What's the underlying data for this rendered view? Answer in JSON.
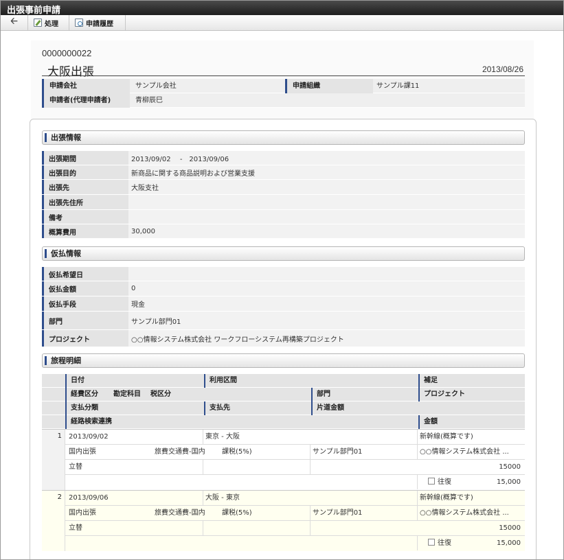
{
  "window": {
    "title": "出張事前申請"
  },
  "toolbar": {
    "back_icon": "arrow-left-icon",
    "process_label": "処理",
    "history_label": "申請履歴"
  },
  "header": {
    "doc_number": "0000000022",
    "subject": "大阪出張",
    "date": "2013/08/26",
    "company_label": "申請会社",
    "company_value": "サンプル会社",
    "org_label": "申請組織",
    "org_value": "サンプル課11",
    "applicant_label": "申請者(代理申請者)",
    "applicant_value": "青柳辰巳"
  },
  "trip_info": {
    "title": "出張情報",
    "rows": [
      {
        "label": "出張期間",
        "value": "2013/09/02　 -　2013/09/06"
      },
      {
        "label": "出張目的",
        "value": "新商品に関する商品説明および営業支援"
      },
      {
        "label": "出張先",
        "value": "大阪支社"
      },
      {
        "label": "出張先住所",
        "value": ""
      },
      {
        "label": "備考",
        "value": ""
      },
      {
        "label": "概算費用",
        "value": "30,000"
      }
    ]
  },
  "advance_info": {
    "title": "仮払情報",
    "rows": [
      {
        "label": "仮払希望日",
        "value": ""
      },
      {
        "label": "仮払金額",
        "value": "0"
      },
      {
        "label": "仮払手段",
        "value": "現金"
      },
      {
        "label": "部門",
        "value": "サンプル部門01"
      },
      {
        "label": "プロジェクト",
        "value": "○○情報システム株式会社 ワークフローシステム再構築プロジェクト"
      }
    ]
  },
  "itinerary": {
    "title": "旅程明細",
    "headers": {
      "date": "日付",
      "route": "利用区間",
      "note": "補足",
      "expense_type": "経費区分",
      "account": "勘定科目",
      "tax": "税区分",
      "dept": "部門",
      "project": "プロジェクト",
      "pay_type": "支払分類",
      "payee": "支払先",
      "oneway": "片道金額",
      "route_search": "経路検索連携",
      "amount": "金額"
    },
    "items": [
      {
        "no": "1",
        "date": "2013/09/02",
        "route": "東京 - 大阪",
        "note": "新幹線(概算です)",
        "expense_type": "国内出張",
        "account": "旅費交通費-国内",
        "tax": "課税(5%)",
        "dept": "サンプル部門01",
        "project": "○○情報システム株式会社 ...",
        "pay_type": "立替",
        "payee": "",
        "oneway": "15000",
        "roundtrip_label": "往復",
        "amount": "15,000"
      },
      {
        "no": "2",
        "date": "2013/09/06",
        "route": "大阪 - 東京",
        "note": "新幹線(概算です)",
        "expense_type": "国内出張",
        "account": "旅費交通費-国内",
        "tax": "課税(5%)",
        "dept": "サンプル部門01",
        "project": "○○情報システム株式会社 ...",
        "pay_type": "立替",
        "payee": "",
        "oneway": "15000",
        "roundtrip_label": "往復",
        "amount": "15,000"
      }
    ]
  },
  "colors": {
    "accent": "#2e4d8c",
    "titlebar": "#2a2a2a",
    "alt_row": "#fffff0"
  }
}
